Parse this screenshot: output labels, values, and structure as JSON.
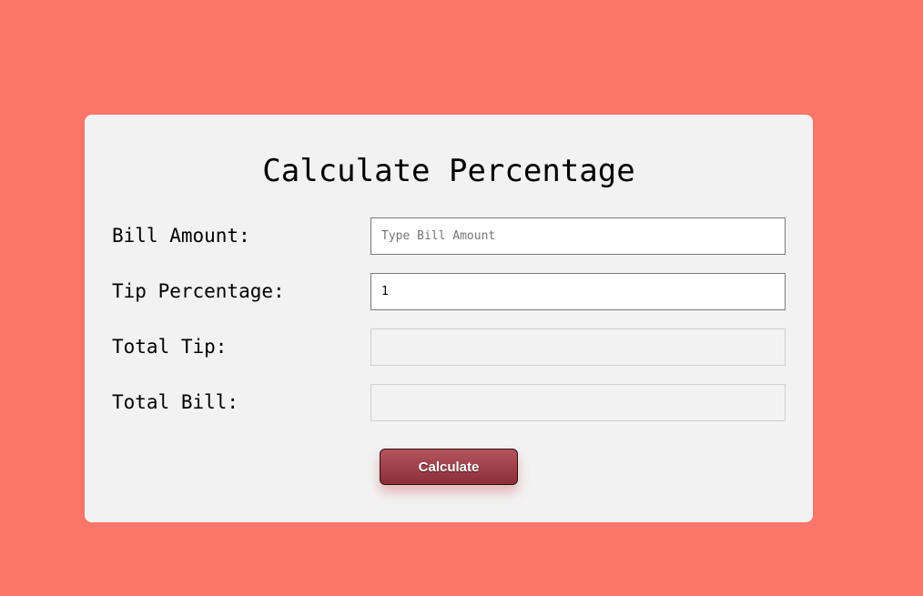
{
  "form": {
    "title": "Calculate Percentage",
    "bill_amount": {
      "label": "Bill Amount:",
      "value": "",
      "placeholder": "Type Bill Amount"
    },
    "tip_percentage": {
      "label": "Tip Percentage:",
      "value": "1",
      "placeholder": ""
    },
    "total_tip": {
      "label": "Total Tip:",
      "value": ""
    },
    "total_bill": {
      "label": "Total Bill:",
      "value": ""
    },
    "calculate_label": "Calculate"
  },
  "colors": {
    "background": "#fc766a",
    "card": "#f2f2f2",
    "button": "#9c3e47"
  }
}
